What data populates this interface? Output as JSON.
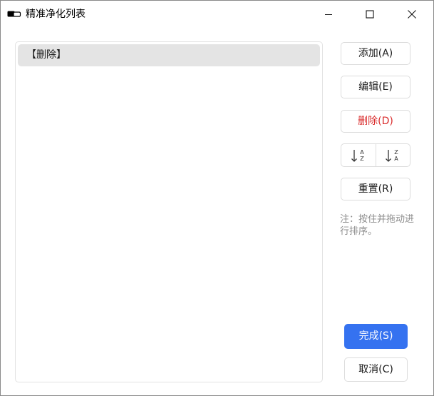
{
  "window": {
    "title": "精准净化列表"
  },
  "list": {
    "items": [
      {
        "label": "【删除】",
        "selected": true
      }
    ]
  },
  "buttons": {
    "add": "添加(A)",
    "edit": "编辑(E)",
    "delete": "删除(D)",
    "reset": "重置(R)",
    "done": "完成(S)",
    "cancel": "取消(C)"
  },
  "sort": {
    "asc": {
      "top": "A",
      "bottom": "Z"
    },
    "desc": {
      "top": "Z",
      "bottom": "A"
    }
  },
  "note": "注：按住并拖动进行排序。",
  "colors": {
    "accent": "#3572f0",
    "danger": "#d92b2b",
    "selection": "#e4e4e4",
    "note": "#8c8c8c"
  },
  "icons": {
    "app": "app-icon",
    "minimize": "minimize-icon",
    "maximize": "maximize-icon",
    "close": "close-icon",
    "sort_asc": "sort-ascending-icon",
    "sort_desc": "sort-descending-icon"
  }
}
